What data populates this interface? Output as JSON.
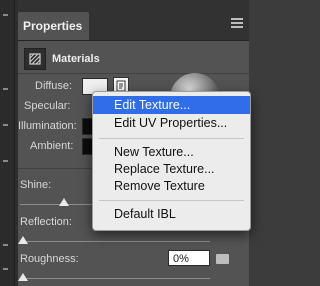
{
  "panel": {
    "tab_title": "Properties",
    "section_title": "Materials"
  },
  "rows": {
    "diffuse_label": "Diffuse:",
    "specular_label": "Specular:",
    "illumination_label": "Illumination:",
    "ambient_label": "Ambient:",
    "shine_label": "Shine:",
    "reflection_label": "Reflection:",
    "roughness_label": "Roughness:",
    "roughness_value": "0%"
  },
  "context_menu": {
    "items": [
      "Edit Texture...",
      "Edit UV Properties...",
      "New Texture...",
      "Replace Texture...",
      "Remove Texture",
      "Default IBL"
    ]
  },
  "colors": {
    "menu_highlight": "#2f6ee8",
    "panel_bg": "#535353"
  }
}
